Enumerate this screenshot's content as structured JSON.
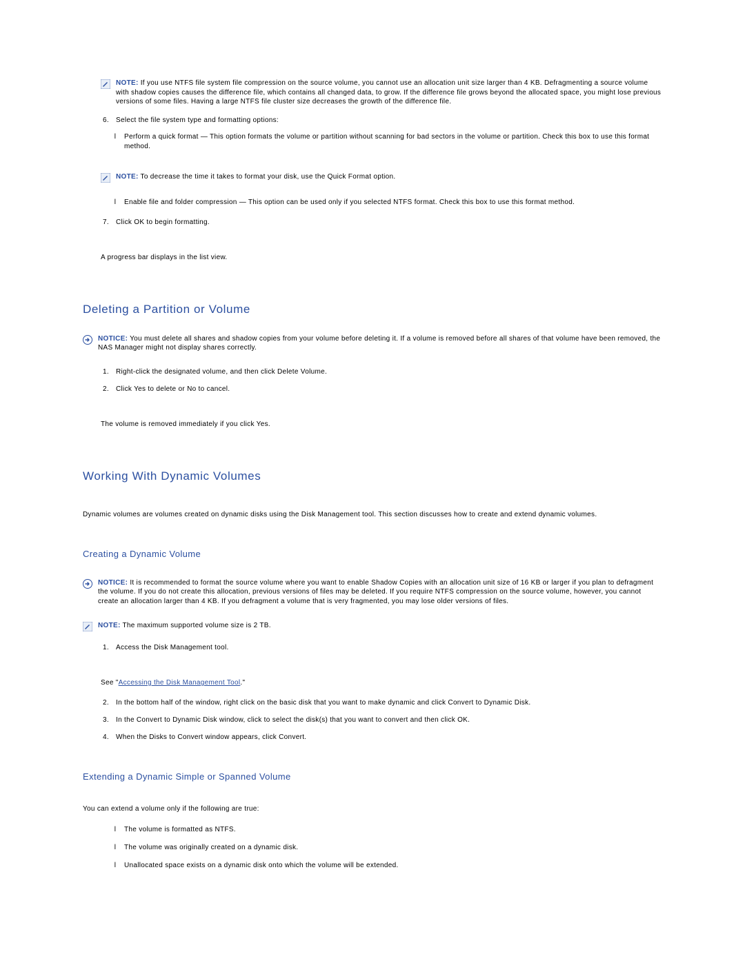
{
  "note1": {
    "lead": "NOTE:",
    "body": "If you use NTFS file system file compression on the source volume, you cannot use an allocation unit size larger than 4 KB. Defragmenting a source volume with shadow copies causes the difference file, which contains all changed data, to grow. If the difference file grows beyond the allocated space, you might lose previous versions of some files. Having a large NTFS file cluster size decreases the growth of the difference file."
  },
  "step6": {
    "num": "6.",
    "body": "Select the file system type and formatting options:",
    "opt1": {
      "mark": "l",
      "body": "Perform a quick format — This option formats the volume or partition without scanning for bad sectors in the volume or partition. Check this box to use this format method."
    },
    "opt2": {
      "mark": "l",
      "body": "Enable file and folder compression — This option can be used only if you selected NTFS format. Check this box to use this format method."
    }
  },
  "note2": {
    "lead": "NOTE:",
    "body": "To decrease the time it takes to format your disk, use the Quick Format option."
  },
  "step7": {
    "num": "7.",
    "body": "Click OK to begin formatting.",
    "after": "A progress bar displays in the list view."
  },
  "sectionDelete": {
    "title": "Deleting a Partition or Volume",
    "notice": {
      "lead": "NOTICE:",
      "body": "You must delete all shares and shadow copies from your volume before deleting it. If a volume is removed before all shares of that volume have been removed, the NAS Manager might not display shares correctly."
    },
    "s1": {
      "num": "1.",
      "body": "Right-click the designated volume, and then click Delete Volume."
    },
    "s2": {
      "num": "2.",
      "body": "Click Yes to delete or No to cancel."
    },
    "after": "The volume is removed immediately if you click Yes."
  },
  "sectionDynamic": {
    "title": "Working With Dynamic Volumes",
    "intro": "Dynamic volumes are volumes created on dynamic disks using the Disk Management tool. This section discusses how to create and extend dynamic volumes."
  },
  "subCreate": {
    "title": "Creating a Dynamic Volume",
    "notice": {
      "lead": "NOTICE:",
      "body": "It is recommended to format the source volume where you want to enable Shadow Copies with an allocation unit size of 16 KB or larger if you plan to defragment the volume. If you do not create this allocation, previous versions of files may be deleted. If you require NTFS compression on the source volume, however, you cannot create an allocation larger than 4 KB. If you defragment a volume that is very fragmented, you may lose older versions of files."
    },
    "note": {
      "lead": "NOTE:",
      "body": "The maximum supported volume size is 2 TB."
    },
    "s1": {
      "num": "1.",
      "body": "Access the Disk Management tool.",
      "see_prefix": "See \"",
      "link": "Accessing the Disk Management Tool",
      "see_suffix": ".\""
    },
    "s2": {
      "num": "2.",
      "body": "In the bottom half of the window, right click on the basic disk that you want to make dynamic and click Convert to Dynamic Disk."
    },
    "s3": {
      "num": "3.",
      "body": "In the Convert to Dynamic Disk window, click to select the disk(s) that you want to convert and then click OK."
    },
    "s4": {
      "num": "4.",
      "body": "When the Disks to Convert window appears, click Convert."
    }
  },
  "subExtend": {
    "title": "Extending a Dynamic Simple or Spanned Volume",
    "intro": "You can extend a volume only if the following are true:",
    "b1": {
      "mark": "l",
      "body": "The volume is formatted as NTFS."
    },
    "b2": {
      "mark": "l",
      "body": "The volume was originally created on a dynamic disk."
    },
    "b3": {
      "mark": "l",
      "body": "Unallocated space exists on a dynamic disk onto which the volume will be extended."
    }
  }
}
